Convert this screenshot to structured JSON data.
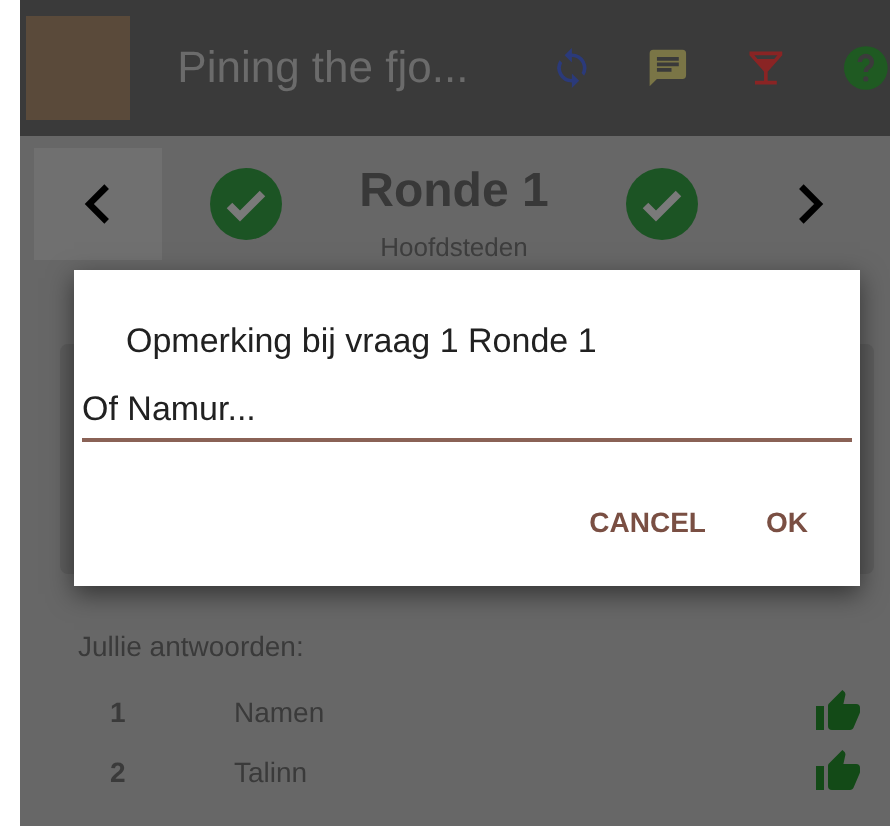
{
  "app_bar": {
    "title": "Pining the fjo..."
  },
  "round": {
    "title": "Ronde 1",
    "subtitle": "Hoofdsteden"
  },
  "answers": {
    "heading": "Jullie antwoorden:",
    "rows": [
      {
        "number": "1",
        "answer": "Namen",
        "correct": true
      },
      {
        "number": "2",
        "answer": "Talinn",
        "correct": true
      }
    ]
  },
  "dialog": {
    "title": "Opmerking bij vraag 1 Ronde 1",
    "value": "Of Namur...",
    "buttons": [
      "CANCEL",
      "OK"
    ]
  }
}
